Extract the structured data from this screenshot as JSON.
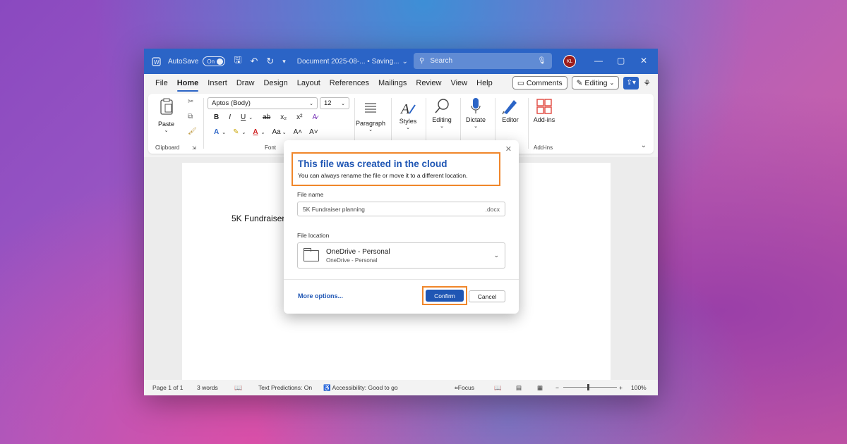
{
  "titlebar": {
    "autosave_label": "AutoSave",
    "autosave_state": "On",
    "doc_title": "Document 2025-08-... • Saving...",
    "search_placeholder": "Search",
    "avatar_initials": "KL"
  },
  "tabs": [
    "File",
    "Home",
    "Insert",
    "Draw",
    "Design",
    "Layout",
    "References",
    "Mailings",
    "Review",
    "View",
    "Help"
  ],
  "active_tab": "Home",
  "tab_actions": {
    "comments": "Comments",
    "editing": "Editing"
  },
  "ribbon": {
    "paste": "Paste",
    "clipboard": "Clipboard",
    "font_name": "Aptos (Body)",
    "font_size": "12",
    "font_group": "Font",
    "paragraph": "Paragraph",
    "styles": "Styles",
    "editing": "Editing",
    "dictate": "Dictate",
    "editor": "Editor",
    "addins": "Add-ins",
    "addins_group": "Add-ins"
  },
  "document": {
    "text": "5K Fundraiser"
  },
  "dialog": {
    "title": "This file was created in the cloud",
    "subtitle": "You can always rename the file or move it to a different location.",
    "file_name_label": "File name",
    "file_name_value": "5K Fundraiser planning",
    "file_ext": ".docx",
    "file_location_label": "File location",
    "location_primary": "OneDrive - Personal",
    "location_secondary": "OneDrive - Personal",
    "more_options": "More options...",
    "confirm": "Confirm",
    "cancel": "Cancel"
  },
  "statusbar": {
    "page": "Page 1 of 1",
    "words": "3 words",
    "text_predictions": "Text Predictions: On",
    "accessibility": "Accessibility: Good to go",
    "focus": "Focus",
    "zoom": "100%"
  },
  "colors": {
    "accent": "#2b64c6",
    "highlight": "#f0862a"
  }
}
